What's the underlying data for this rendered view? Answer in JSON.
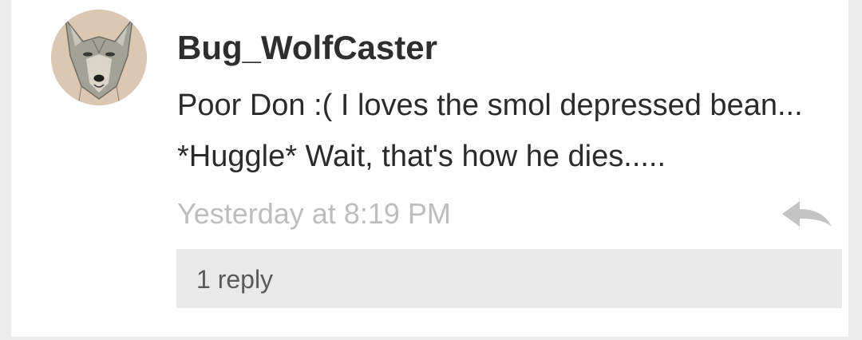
{
  "comment": {
    "username": "Bug_WolfCaster",
    "body": "Poor Don :( I loves the smol depressed bean... *Huggle* Wait, that's how he dies.....",
    "timestamp": "Yesterday at 8:19 PM",
    "replies_label": "1 reply",
    "avatar_icon": "wolf-portrait",
    "reply_icon": "reply-arrow-icon"
  },
  "colors": {
    "card_background": "#ffffff",
    "page_background": "#ececec",
    "username_text": "#2e2e2e",
    "body_text": "#2b2b2b",
    "timestamp_text": "#bdbdbd",
    "replies_bar": "#e9e9e9",
    "reply_icon": "#c4c4c4"
  }
}
